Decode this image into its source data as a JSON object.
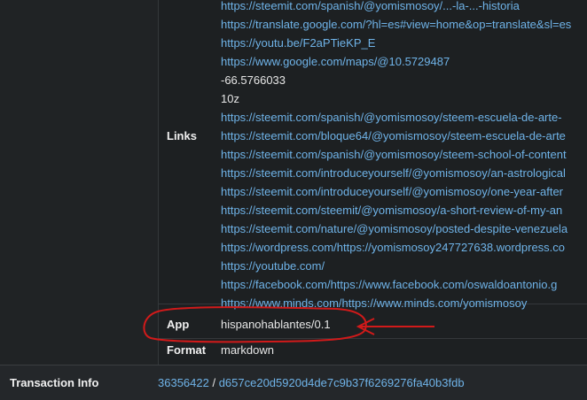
{
  "links_section": {
    "label": "Links",
    "items": [
      {
        "text": "https://steemit.com/spanish/@yomismosoy/...-la-...-historia",
        "link": true
      },
      {
        "text": "https://translate.google.com/?hl=es#view=home&op=translate&sl=es",
        "link": true
      },
      {
        "text": "https://youtu.be/F2aPTieKP_E",
        "link": true
      },
      {
        "text": "https://www.google.com/maps/@10.5729487",
        "link": true
      },
      {
        "text": "-66.5766033",
        "link": false
      },
      {
        "text": "10z",
        "link": false
      },
      {
        "text": "https://steemit.com/spanish/@yomismosoy/steem-escuela-de-arte-",
        "link": true
      },
      {
        "text": "https://steemit.com/bloque64/@yomismosoy/steem-escuela-de-arte",
        "link": true
      },
      {
        "text": "https://steemit.com/spanish/@yomismosoy/steem-school-of-content",
        "link": true
      },
      {
        "text": "https://steemit.com/introduceyourself/@yomismosoy/an-astrological",
        "link": true
      },
      {
        "text": "https://steemit.com/introduceyourself/@yomismosoy/one-year-after",
        "link": true
      },
      {
        "text": "https://steemit.com/steemit/@yomismosoy/a-short-review-of-my-an",
        "link": true
      },
      {
        "text": "https://steemit.com/nature/@yomismosoy/posted-despite-venezuela",
        "link": true
      },
      {
        "text": "https://wordpress.com/https://yomismosoy247727638.wordpress.co",
        "link": true
      },
      {
        "text": "https://youtube.com/",
        "link": true
      },
      {
        "text": "https://facebook.com/https://www.facebook.com/oswaldoantonio.g",
        "link": true
      },
      {
        "text": "https://www.minds.com/https://www.minds.com/yomismosoy",
        "link": true
      }
    ]
  },
  "app_row": {
    "label": "App",
    "value": "hispanohablantes/0.1"
  },
  "format_row": {
    "label": "Format",
    "value": "markdown"
  },
  "transaction": {
    "label": "Transaction Info",
    "block": "36356422",
    "separator": " / ",
    "hash": "d657ce20d5920d4de7c9b37f6269276fa40b3fdb"
  },
  "annotation": {
    "color": "#d11a1a"
  },
  "colors": {
    "link": "#6fb3e8",
    "text": "#e6e6e6",
    "background": "#1b1e20"
  }
}
